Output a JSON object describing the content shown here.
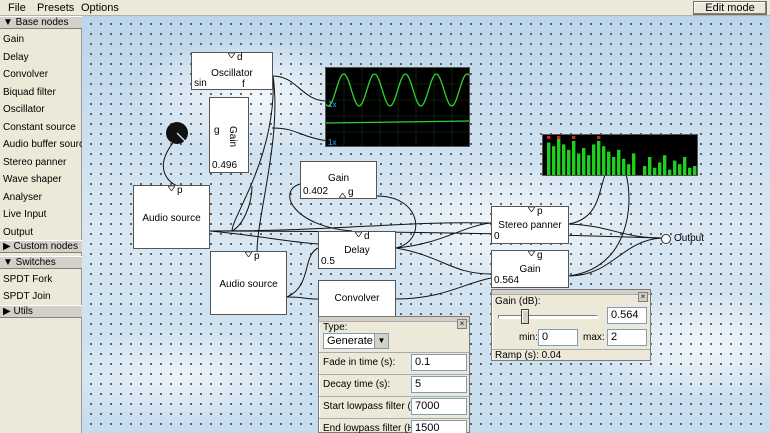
{
  "menubar": {
    "file": "File",
    "presets": "Presets",
    "options": "Options",
    "edit_mode": "Edit mode"
  },
  "sidebar": {
    "base_nodes_header": "▼ Base nodes",
    "base_nodes": [
      "Gain",
      "Delay",
      "Convolver",
      "Biquad filter",
      "Oscillator",
      "Constant source",
      "Audio buffer source",
      "Stereo panner",
      "Wave shaper",
      "Analyser",
      "Live Input",
      "Output"
    ],
    "custom_nodes_header": "▶ Custom nodes",
    "switches_header": "▼ Switches",
    "switches": [
      "SPDT Fork",
      "SPDT Join"
    ],
    "utils_header": "▶ Utils"
  },
  "nodes": {
    "oscillator": {
      "title": "Oscillator",
      "port": "d",
      "port_f": "f",
      "value": "sin"
    },
    "gain_v": {
      "title": "Gain",
      "port": "g",
      "value": "0.496"
    },
    "audio_source_1": {
      "title": "Audio source",
      "port": "p"
    },
    "audio_source_2": {
      "title": "Audio source",
      "port": "p"
    },
    "gain_mid": {
      "title": "Gain",
      "port": "g",
      "value": "0.402"
    },
    "delay": {
      "title": "Delay",
      "port": "d",
      "value": "0.5"
    },
    "convolver": {
      "title": "Convolver"
    },
    "stereo_panner": {
      "title": "Stereo panner",
      "port": "p",
      "value": "0"
    },
    "gain_right": {
      "title": "Gain",
      "port": "g",
      "value": "0.564"
    },
    "output": {
      "title": "Output"
    }
  },
  "scope": {
    "label_top": "1x",
    "label_bottom": "1x"
  },
  "analyser_bars": [
    0.9,
    0.8,
    1.0,
    0.85,
    0.7,
    0.95,
    0.6,
    0.75,
    0.55,
    0.85,
    0.95,
    0.8,
    0.65,
    0.5,
    0.7,
    0.45,
    0.3,
    0.6,
    0.25,
    0.5,
    0.2,
    0.35,
    0.55,
    0.15,
    0.4,
    0.3,
    0.5,
    0.2,
    0.25
  ],
  "gain_panel": {
    "title": "Gain (dB):",
    "value": "0.564",
    "slider_fraction": 0.25,
    "min_label": "min:",
    "min_value": "0",
    "max_label": "max:",
    "max_value": "2",
    "ramp": "Ramp (s): 0.04"
  },
  "convolver_panel": {
    "type_label": "Type:",
    "type_value": "Generate",
    "fade_label": "Fade in time (s):",
    "fade_value": "0.1",
    "decay_label": "Decay time (s):",
    "decay_value": "5",
    "start_lp_label": "Start lowpass filter (Hz):",
    "start_lp_value": "7000",
    "end_lp_label": "End lowpass filter (Hz):",
    "end_lp_value": "1500"
  },
  "colors": {
    "scope_wave": "#2fd42f",
    "analyser_bar": "#1fcf1f",
    "analyser_peak": "#e02020"
  }
}
